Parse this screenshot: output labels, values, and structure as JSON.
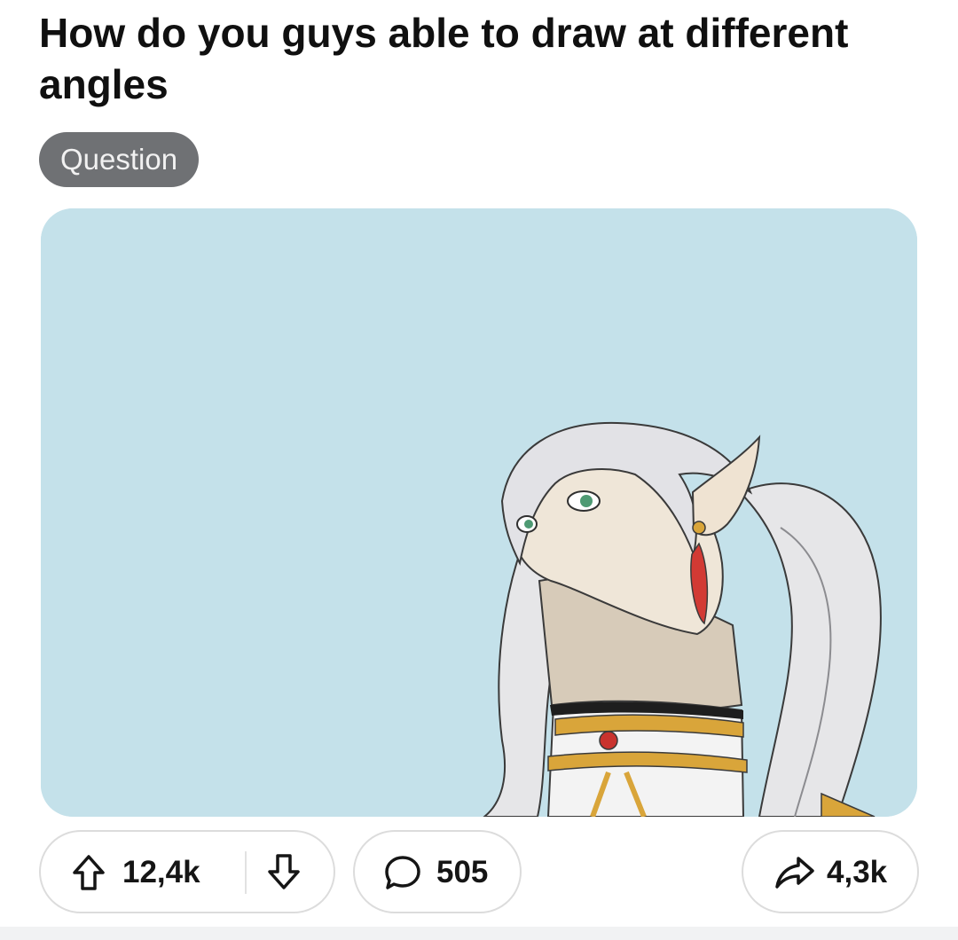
{
  "post": {
    "title": "How do you guys able to draw at different angles",
    "flair": "Question",
    "image_description_icon": "illustration-image"
  },
  "actions": {
    "upvotes": "12,4k",
    "comments": "505",
    "shares": "4,3k"
  },
  "colors": {
    "flair_bg": "#6f7174",
    "image_bg": "#c4e1ea",
    "pill_border": "#dcdcdc"
  }
}
